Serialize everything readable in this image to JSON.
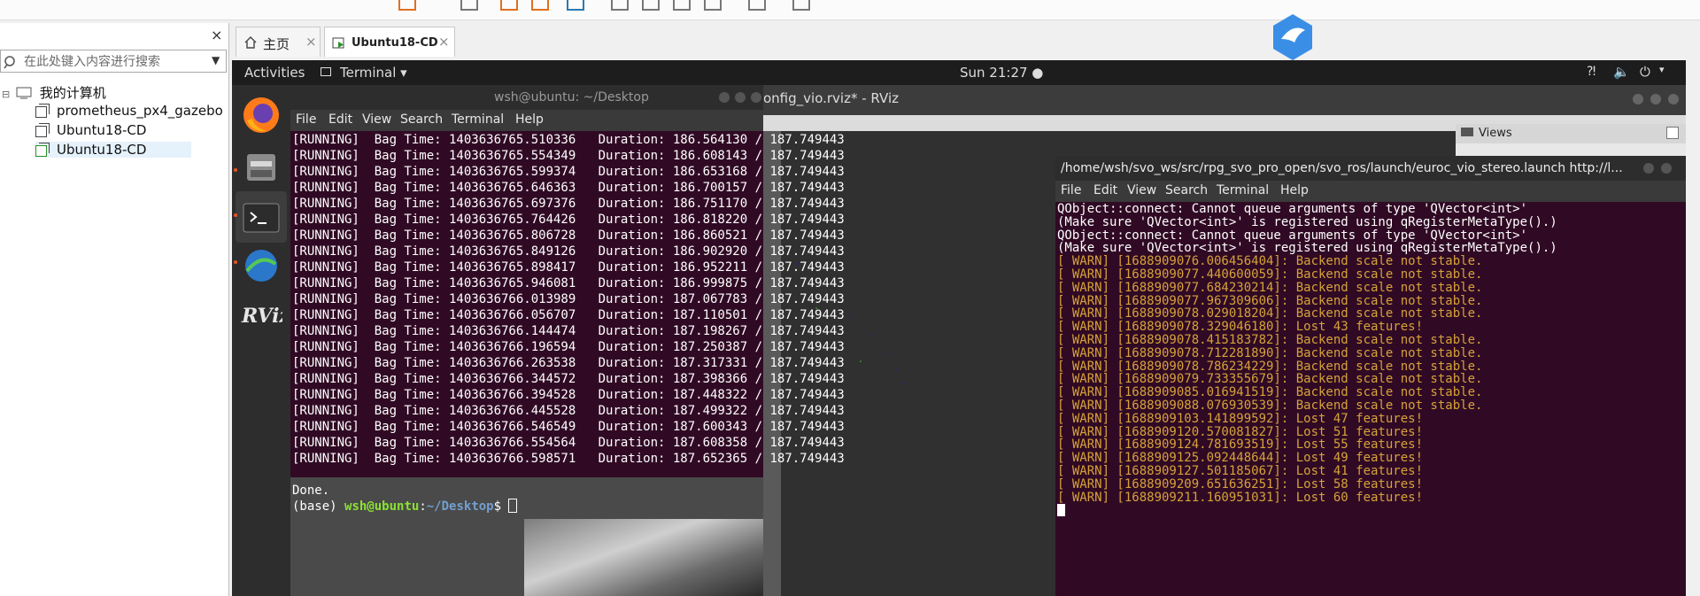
{
  "library": {
    "close": "×",
    "search_placeholder": "在此处键入内容进行搜索",
    "root": "我的计算机",
    "vms": [
      "prometheus_px4_gazebo",
      "Ubuntu18-CD",
      "Ubuntu18-CD"
    ]
  },
  "tabs": [
    {
      "label": "主页",
      "close": "×"
    },
    {
      "label": "Ubuntu18-CD",
      "close": "×"
    }
  ],
  "ubuntu": {
    "activities": "Activities",
    "app_menu": "Terminal ▾",
    "clock": "Sun 21:27 ●"
  },
  "rviz": {
    "title": "onfig_vio.rviz* - RViz",
    "views_label": "Views"
  },
  "terminal1": {
    "title": "wsh@ubuntu: ~/Desktop",
    "menu": [
      "File",
      "Edit",
      "View",
      "Search",
      "Terminal",
      "Help"
    ],
    "lines": [
      "[RUNNING]  Bag Time: 1403636765.510336   Duration: 186.564130 / 187.749443",
      "[RUNNING]  Bag Time: 1403636765.554349   Duration: 186.608143 / 187.749443",
      "[RUNNING]  Bag Time: 1403636765.599374   Duration: 186.653168 / 187.749443",
      "[RUNNING]  Bag Time: 1403636765.646363   Duration: 186.700157 / 187.749443",
      "[RUNNING]  Bag Time: 1403636765.697376   Duration: 186.751170 / 187.749443",
      "[RUNNING]  Bag Time: 1403636765.764426   Duration: 186.818220 / 187.749443",
      "[RUNNING]  Bag Time: 1403636765.806728   Duration: 186.860521 / 187.749443",
      "[RUNNING]  Bag Time: 1403636765.849126   Duration: 186.902920 / 187.749443",
      "[RUNNING]  Bag Time: 1403636765.898417   Duration: 186.952211 / 187.749443",
      "[RUNNING]  Bag Time: 1403636765.946081   Duration: 186.999875 / 187.749443",
      "[RUNNING]  Bag Time: 1403636766.013989   Duration: 187.067783 / 187.749443",
      "[RUNNING]  Bag Time: 1403636766.056707   Duration: 187.110501 / 187.749443",
      "[RUNNING]  Bag Time: 1403636766.144474   Duration: 187.198267 / 187.749443",
      "[RUNNING]  Bag Time: 1403636766.196594   Duration: 187.250387 / 187.749443",
      "[RUNNING]  Bag Time: 1403636766.263538   Duration: 187.317331 / 187.749443",
      "[RUNNING]  Bag Time: 1403636766.344572   Duration: 187.398366 / 187.749443",
      "[RUNNING]  Bag Time: 1403636766.394528   Duration: 187.448322 / 187.749443",
      "[RUNNING]  Bag Time: 1403636766.445528   Duration: 187.499322 / 187.749443",
      "[RUNNING]  Bag Time: 1403636766.546549   Duration: 187.600343 / 187.749443",
      "[RUNNING]  Bag Time: 1403636766.554564   Duration: 187.608358 / 187.749443",
      "[RUNNING]  Bag Time: 1403636766.598571   Duration: 187.652365 / 187.749443"
    ],
    "done": "Done.",
    "prompt_prefix": "(base) ",
    "prompt_user": "wsh@ubuntu",
    "prompt_sep": ":",
    "prompt_path": "~/Desktop",
    "prompt_end": "$ "
  },
  "terminal2": {
    "title": "/home/wsh/svo_ws/src/rpg_svo_pro_open/svo_ros/launch/euroc_vio_stereo.launch http://l...",
    "menu": [
      "File",
      "Edit",
      "View",
      "Search",
      "Terminal",
      "Help"
    ],
    "plain_lines": [
      "QObject::connect: Cannot queue arguments of type 'QVector<int>'",
      "(Make sure 'QVector<int>' is registered using qRegisterMetaType().)",
      "QObject::connect: Cannot queue arguments of type 'QVector<int>'",
      "(Make sure 'QVector<int>' is registered using qRegisterMetaType().)"
    ],
    "warn_lines": [
      "[ WARN] [1688909076.006456404]: Backend scale not stable.",
      "[ WARN] [1688909077.440600059]: Backend scale not stable.",
      "[ WARN] [1688909077.684230214]: Backend scale not stable.",
      "[ WARN] [1688909077.967309606]: Backend scale not stable.",
      "[ WARN] [1688909078.029018204]: Backend scale not stable.",
      "[ WARN] [1688909078.329046180]: Lost 43 features!",
      "[ WARN] [1688909078.415183782]: Backend scale not stable.",
      "[ WARN] [1688909078.712281890]: Backend scale not stable.",
      "[ WARN] [1688909078.786234229]: Backend scale not stable.",
      "[ WARN] [1688909079.733355679]: Backend scale not stable.",
      "[ WARN] [1688909085.016941519]: Backend scale not stable.",
      "[ WARN] [1688909088.076930539]: Backend scale not stable.",
      "[ WARN] [1688909103.141899592]: Lost 47 features!",
      "[ WARN] [1688909120.570081827]: Lost 51 features!",
      "[ WARN] [1688909124.781693519]: Lost 55 features!",
      "[ WARN] [1688909125.092448644]: Lost 49 features!",
      "[ WARN] [1688909127.501185067]: Lost 41 features!",
      "[ WARN] [1688909209.651636251]: Lost 58 features!",
      "[ WARN] [1688909211.160951031]: Lost 60 features!"
    ]
  },
  "colors": {
    "terminal_bg": "#300a24",
    "warn": "#d6a23a",
    "prompt_user": "#8ae234",
    "prompt_path": "#729fcf"
  }
}
